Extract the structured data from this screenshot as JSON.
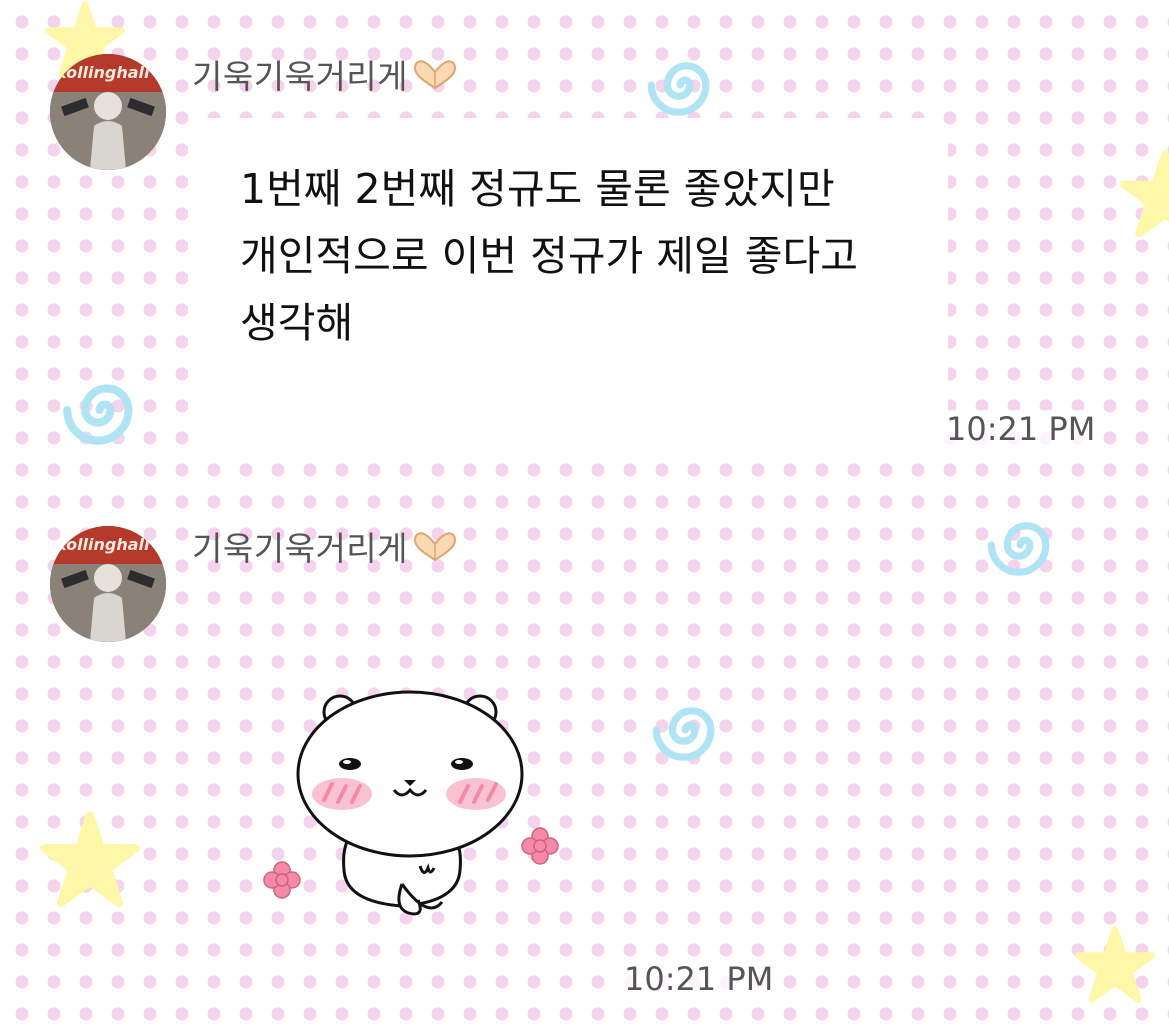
{
  "messages": [
    {
      "sender": "기욱기욱거리게",
      "avatar_icon": "profile-photo",
      "name_emoji_icon": "heart-hands-icon",
      "text": "1번째 2번째 정규도 물론 좋았지만 개인적으로 이번 정규가 제일 좋다고 생각해",
      "time": "10:21 PM"
    },
    {
      "sender": "기욱기욱거리게",
      "avatar_icon": "profile-photo",
      "name_emoji_icon": "heart-hands-icon",
      "sticker_icon": "blushing-bear-sticker",
      "time": "10:21 PM"
    }
  ],
  "colors": {
    "dot": "#f4d3ec",
    "star": "#fff7a8",
    "swirl": "#aee4f4",
    "blush": "#f58aa8"
  }
}
